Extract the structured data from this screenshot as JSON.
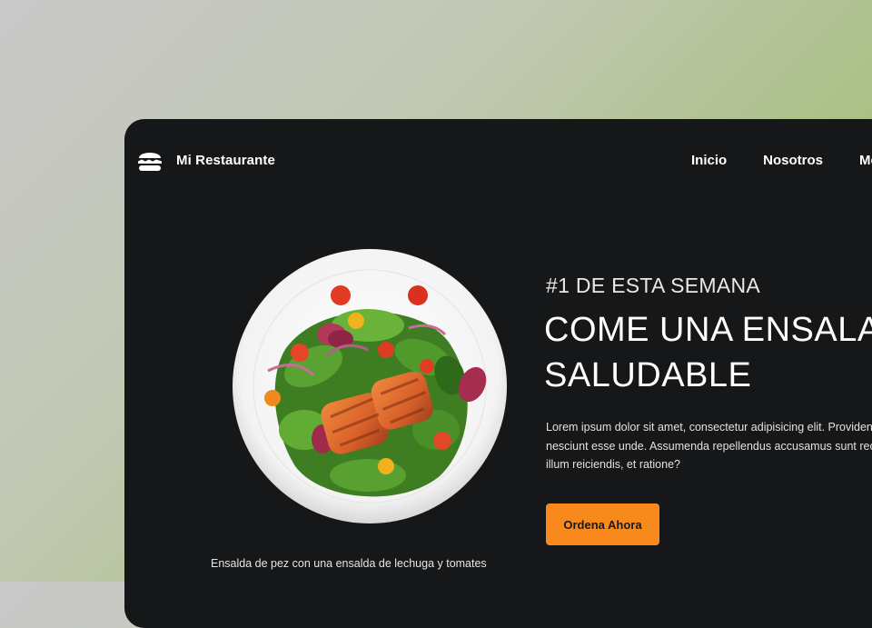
{
  "brand": {
    "name": "Mi Restaurante",
    "icon": "burger-icon"
  },
  "nav": {
    "items": [
      "Inicio",
      "Nosotros",
      "Menú"
    ]
  },
  "hero": {
    "eyebrow": "#1 DE ESTA SEMANA",
    "headline_line1": "COME UNA ENSALADA",
    "headline_line2": "SALUDABLE",
    "description": "Lorem ipsum dolor sit amet, consectetur adipisicing elit. Provident modi nesciunt esse unde. Assumenda repellendus accusamus sunt recusandae illum reiciendis, et ratione?",
    "cta_label": "Ordena Ahora",
    "image_caption": "Ensalda de pez con una ensalda de lechuga y tomates"
  },
  "colors": {
    "card_bg": "#151719",
    "accent": "#f8891d",
    "text": "#ffffff"
  }
}
